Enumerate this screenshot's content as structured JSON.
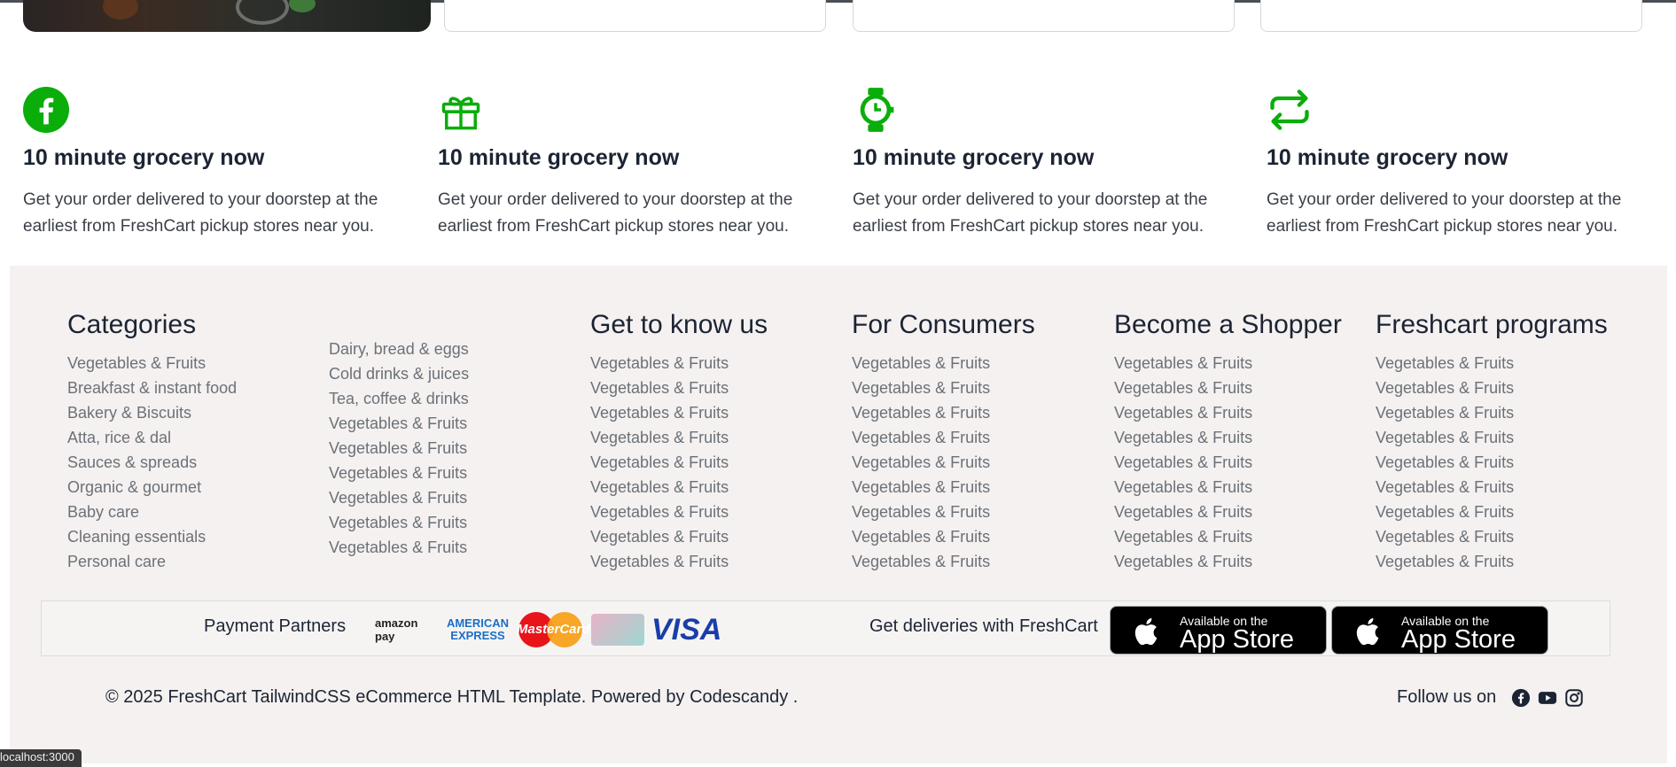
{
  "features": [
    {
      "icon": "facebook-icon",
      "title": "10 minute grocery now",
      "text": "Get your order delivered to your doorstep at the earliest from FreshCart pickup stores near you."
    },
    {
      "icon": "gift-icon",
      "title": "10 minute grocery now",
      "text": "Get your order delivered to your doorstep at the earliest from FreshCart pickup stores near you."
    },
    {
      "icon": "watch-icon",
      "title": "10 minute grocery now",
      "text": "Get your order delivered to your doorstep at the earliest from FreshCart pickup stores near you."
    },
    {
      "icon": "repeat-icon",
      "title": "10 minute grocery now",
      "text": "Get your order delivered to your doorstep at the earliest from FreshCart pickup stores near you."
    }
  ],
  "footer": {
    "categories": {
      "title": "Categories",
      "col1": [
        "Vegetables & Fruits",
        "Breakfast & instant food",
        "Bakery & Biscuits",
        "Atta, rice & dal",
        "Sauces & spreads",
        "Organic & gourmet",
        "Baby care",
        "Cleaning essentials",
        "Personal care"
      ],
      "col2": [
        "Dairy, bread & eggs",
        "Cold drinks & juices",
        "Tea, coffee & drinks",
        "Vegetables & Fruits",
        "Vegetables & Fruits",
        "Vegetables & Fruits",
        "Vegetables & Fruits",
        "Vegetables & Fruits",
        "Vegetables & Fruits"
      ]
    },
    "get_to_know": {
      "title": "Get to know us",
      "items": [
        "Vegetables & Fruits",
        "Vegetables & Fruits",
        "Vegetables & Fruits",
        "Vegetables & Fruits",
        "Vegetables & Fruits",
        "Vegetables & Fruits",
        "Vegetables & Fruits",
        "Vegetables & Fruits",
        "Vegetables & Fruits"
      ]
    },
    "consumers": {
      "title": "For Consumers",
      "items": [
        "Vegetables & Fruits",
        "Vegetables & Fruits",
        "Vegetables & Fruits",
        "Vegetables & Fruits",
        "Vegetables & Fruits",
        "Vegetables & Fruits",
        "Vegetables & Fruits",
        "Vegetables & Fruits",
        "Vegetables & Fruits"
      ]
    },
    "shopper": {
      "title": "Become a Shopper",
      "items": [
        "Vegetables & Fruits",
        "Vegetables & Fruits",
        "Vegetables & Fruits",
        "Vegetables & Fruits",
        "Vegetables & Fruits",
        "Vegetables & Fruits",
        "Vegetables & Fruits",
        "Vegetables & Fruits",
        "Vegetables & Fruits"
      ]
    },
    "programs": {
      "title": "Freshcart programs",
      "items": [
        "Vegetables & Fruits",
        "Vegetables & Fruits",
        "Vegetables & Fruits",
        "Vegetables & Fruits",
        "Vegetables & Fruits",
        "Vegetables & Fruits",
        "Vegetables & Fruits",
        "Vegetables & Fruits",
        "Vegetables & Fruits"
      ]
    },
    "payment_label": "Payment Partners",
    "payment_logos": {
      "amazon": "amazon pay",
      "amex": "AMERICAN EXPRESS",
      "mastercard": "MasterCard",
      "visa": "VISA"
    },
    "deliveries_label": "Get deliveries with FreshCart",
    "app_store": {
      "small": "Available on the",
      "big": "App Store"
    },
    "copyright": "© 2025 FreshCart TailwindCSS eCommerce HTML Template. Powered by Codescandy .",
    "follow_label": "Follow us on"
  },
  "status_url": "localhost:3000",
  "colors": {
    "accent": "#0aad0a",
    "footer_bg": "#f4f1f0"
  }
}
